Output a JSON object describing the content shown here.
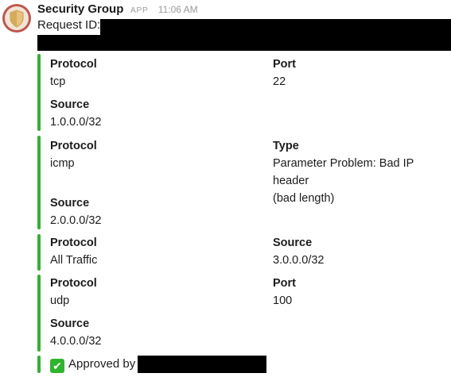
{
  "message": {
    "sender": "Security Group",
    "app_badge": "APP",
    "time": "11:06 AM",
    "request_label": "Request ID:"
  },
  "attachments": [
    {
      "left": [
        {
          "label": "Protocol",
          "value": "tcp"
        },
        {
          "label": "Source",
          "value": "1.0.0.0/32"
        }
      ],
      "right": [
        {
          "label": "Port",
          "value": "22"
        }
      ]
    },
    {
      "left": [
        {
          "label": "Protocol",
          "value": "icmp"
        },
        {
          "label": "Source",
          "value": "2.0.0.0/32"
        }
      ],
      "right": [
        {
          "label": "Type",
          "value_line1": "Parameter Problem: Bad IP header",
          "value_line2": "(bad length)"
        }
      ]
    },
    {
      "left": [
        {
          "label": "Protocol",
          "value": "All Traffic"
        }
      ],
      "right": [
        {
          "label": "Source",
          "value": "3.0.0.0/32"
        }
      ]
    },
    {
      "left": [
        {
          "label": "Protocol",
          "value": "udp"
        },
        {
          "label": "Source",
          "value": "4.0.0.0/32"
        }
      ],
      "right": [
        {
          "label": "Port",
          "value": "100"
        }
      ]
    }
  ],
  "approval": {
    "icon": "white-check-mark-icon",
    "text": "Approved by"
  },
  "colors": {
    "accent_bar": "#2eb52d",
    "avatar_bg": "#c0564e",
    "shield": "#e6c27a"
  }
}
